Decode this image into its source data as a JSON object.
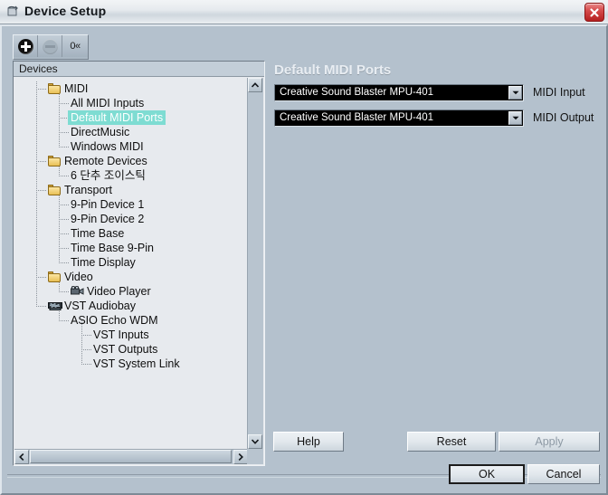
{
  "window": {
    "title": "Device Setup",
    "title_icon": "window-restore-icon",
    "close_label": "x"
  },
  "toolbar": {
    "add_label": "+",
    "remove_label": "-",
    "preset_label": "0«"
  },
  "tree": {
    "header": "Devices",
    "selected": "Default MIDI Ports",
    "items": [
      {
        "label": "MIDI",
        "depth": 0,
        "icon": "folder-icon"
      },
      {
        "label": "All MIDI Inputs",
        "depth": 1,
        "icon": "none"
      },
      {
        "label": "Default MIDI Ports",
        "depth": 1,
        "icon": "none"
      },
      {
        "label": "DirectMusic",
        "depth": 1,
        "icon": "none"
      },
      {
        "label": "Windows MIDI",
        "depth": 1,
        "icon": "none"
      },
      {
        "label": "Remote Devices",
        "depth": 0,
        "icon": "folder-icon"
      },
      {
        "label": "6 단추 조이스틱",
        "depth": 1,
        "icon": "none"
      },
      {
        "label": "Transport",
        "depth": 0,
        "icon": "folder-icon"
      },
      {
        "label": "9-Pin Device 1",
        "depth": 1,
        "icon": "none"
      },
      {
        "label": "9-Pin Device 2",
        "depth": 1,
        "icon": "none"
      },
      {
        "label": "Time Base",
        "depth": 1,
        "icon": "none"
      },
      {
        "label": "Time Base 9-Pin",
        "depth": 1,
        "icon": "none"
      },
      {
        "label": "Time Display",
        "depth": 1,
        "icon": "none"
      },
      {
        "label": "Video",
        "depth": 0,
        "icon": "folder-icon"
      },
      {
        "label": "Video Player",
        "depth": 1,
        "icon": "video-camera-icon"
      },
      {
        "label": "VST Audiobay",
        "depth": 0,
        "icon": "audio-device-icon"
      },
      {
        "label": "ASIO Echo WDM",
        "depth": 1,
        "icon": "none"
      },
      {
        "label": "VST Inputs",
        "depth": 2,
        "icon": "none"
      },
      {
        "label": "VST Outputs",
        "depth": 2,
        "icon": "none"
      },
      {
        "label": "VST System Link",
        "depth": 2,
        "icon": "none"
      }
    ]
  },
  "panel": {
    "title": "Default MIDI Ports",
    "rows": [
      {
        "value": "Creative Sound Blaster MPU-401",
        "label": "MIDI Input"
      },
      {
        "value": "Creative Sound Blaster MPU-401",
        "label": "MIDI Output"
      }
    ]
  },
  "buttons": {
    "help": "Help",
    "reset": "Reset",
    "apply": "Apply",
    "ok": "OK",
    "cancel": "Cancel"
  },
  "colors": {
    "window_bg": "#b4c1cd",
    "tree_bg": "#e7eaee",
    "selection": "#7edcd2",
    "combo_bg": "#000000",
    "close_red": "#c42f2f"
  }
}
